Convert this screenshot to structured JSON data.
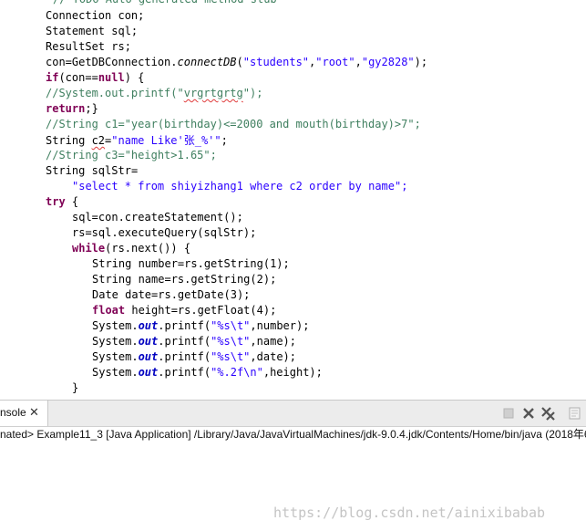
{
  "editor": {
    "lines": [
      "// TODO Auto-generated method stub",
      "Connection con;",
      "Statement sql;",
      "ResultSet rs;",
      "con=GetDBConnection.connectDB(\"students\",\"root\",\"gy2828\");",
      "if(con==null) {",
      "//System.out.printf(\"vrgrtgrtg\");",
      "return;}",
      "//String c1=\"year(birthday)<=2000 and mouth(birthday)>7\";",
      "String c2=\"name Like'张_%'\";",
      "//String c3=\"height>1.65\";",
      "String sqlStr=",
      "\"select * from shiyizhang1 where c2 order by name\";",
      "try {",
      "sql=con.createStatement();",
      "rs=sql.executeQuery(sqlStr);",
      "while(rs.next()) {",
      "String number=rs.getString(1);",
      "String name=rs.getString(2);",
      "Date date=rs.getDate(3);",
      "float height=rs.getFloat(4);",
      "System.out.printf(\"%s\\t\",number);",
      "System.out.printf(\"%s\\t\",name);",
      "System.out.printf(\"%s\\t\",date);",
      "System.out.printf(\"%.2f\\n\",height);",
      "}"
    ],
    "colors": {
      "keyword": "#7f0055",
      "string": "#2a00ff",
      "comment": "#3f7f5f",
      "field": "#0000c0",
      "error_underline": "#e03c3c"
    }
  },
  "console": {
    "tab_label": "nsole",
    "close_icon": "close-icon",
    "toolbar_icons": [
      "terminate-icon",
      "remove-launch-icon",
      "remove-all-terminated-icon",
      "new-console-icon"
    ],
    "status_text": "nated> Example11_3 [Java Application] /Library/Java/JavaVirtualMachines/jdk-9.0.4.jdk/Contents/Home/bin/java (2018年6"
  },
  "watermark": "https://blog.csdn.net/ainixibabab"
}
